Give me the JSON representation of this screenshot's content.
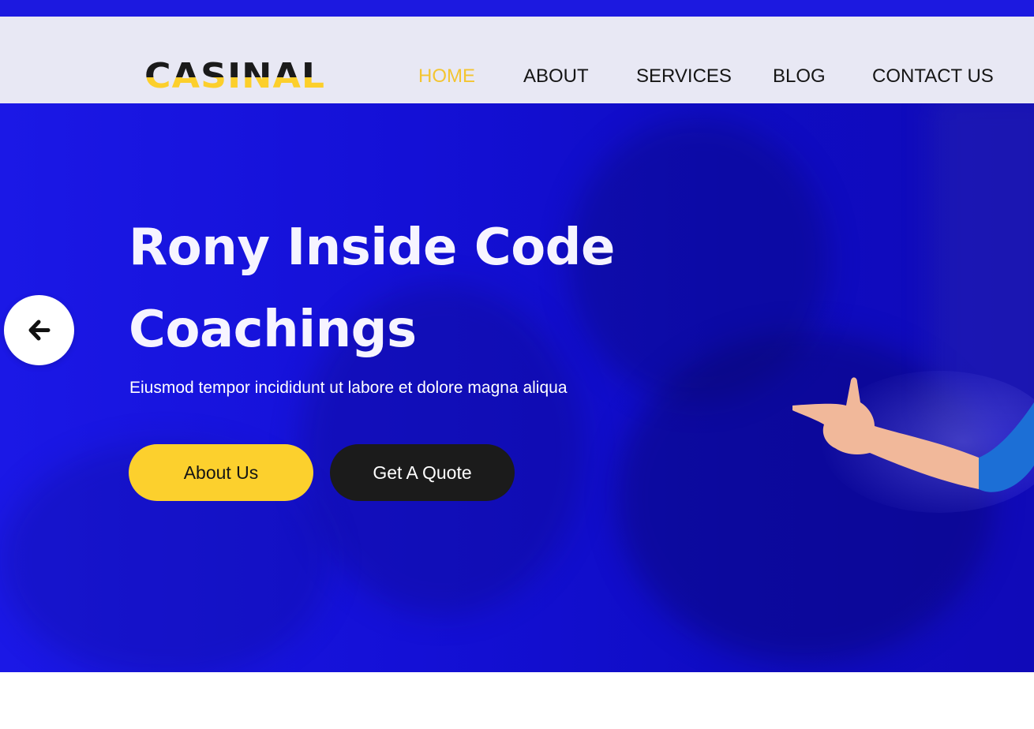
{
  "brand": {
    "logo_text": "CASINAL"
  },
  "nav": {
    "items": [
      {
        "label": "HOME",
        "active": true
      },
      {
        "label": "ABOUT",
        "active": false
      },
      {
        "label": "SERVICES",
        "active": false
      },
      {
        "label": "BLOG",
        "active": false
      },
      {
        "label": "CONTACT US",
        "active": false
      }
    ]
  },
  "hero": {
    "title_line1": "Rony Inside Code",
    "title_line2": "Coachings",
    "subtitle": "Eiusmod tempor incididunt ut labore et dolore magna aliqua",
    "primary_button": "About Us",
    "secondary_button": "Get A Quote",
    "prev_control_icon": "arrow-left-icon"
  },
  "colors": {
    "hero_blue": "#1410d6",
    "accent_yellow": "#fcd02d",
    "active_nav": "#f3c531",
    "dark_button": "#1b1b1b",
    "header_bg": "#e8e8f4"
  }
}
